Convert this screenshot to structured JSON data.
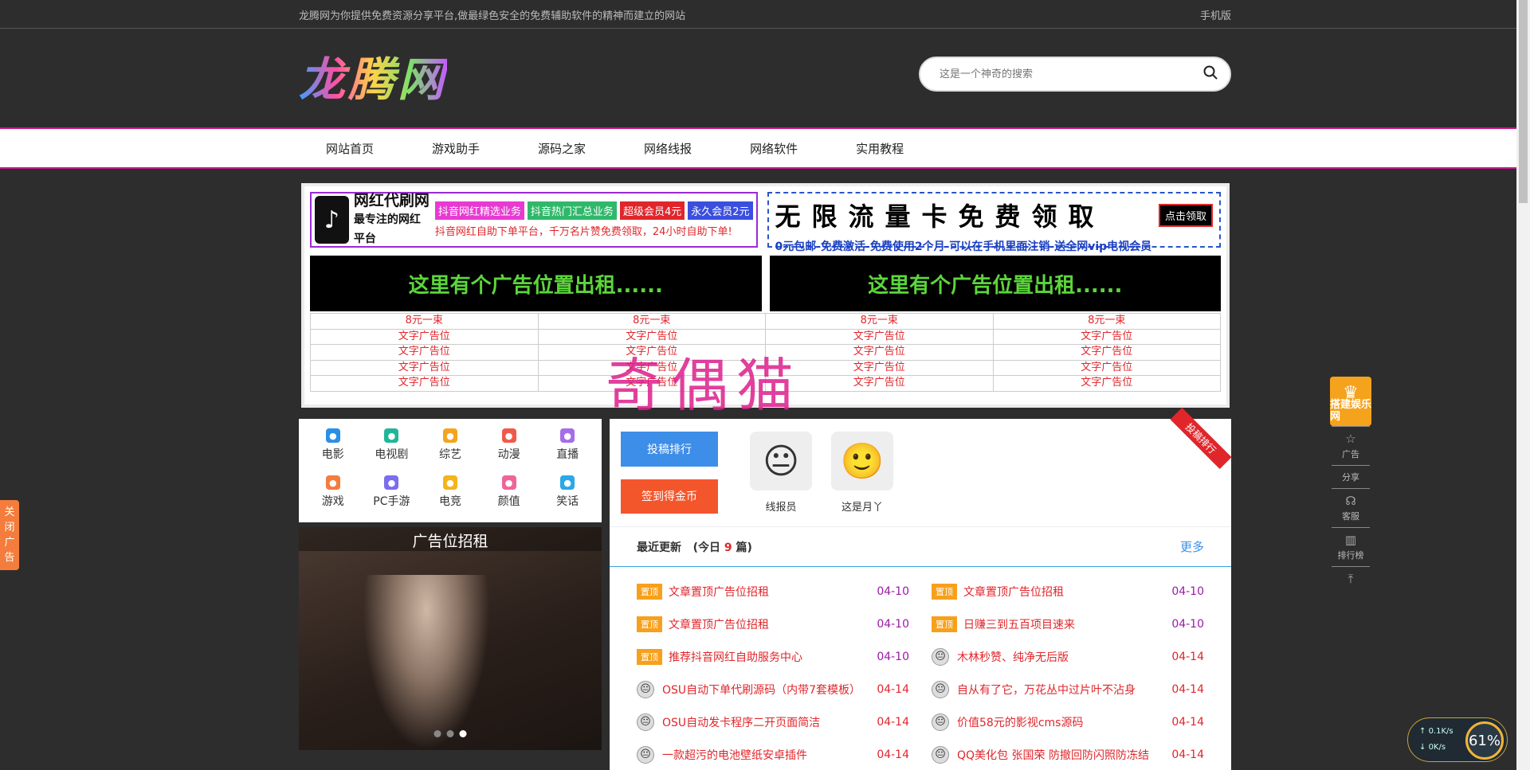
{
  "topbar": {
    "slogan": "龙腾网为你提供免费资源分享平台,做最绿色安全的免费辅助软件的精神而建立的网站",
    "mobile_link": "手机版"
  },
  "logo": {
    "text": "龙腾网"
  },
  "search": {
    "placeholder": "这是一个神奇的搜索",
    "icon": "search-icon"
  },
  "nav": {
    "items": [
      "网站首页",
      "游戏助手",
      "源码之家",
      "网络线报",
      "网络软件",
      "实用教程"
    ]
  },
  "ads": {
    "banner1": {
      "title": "网红代刷网",
      "subtitle": "最专注的网红平台",
      "tags": [
        {
          "label": "抖音网红精选业务",
          "color": "#e83ad2"
        },
        {
          "label": "抖音热门汇总业务",
          "color": "#2fb86a"
        },
        {
          "label": "超级会员4元",
          "color": "#e0262b"
        },
        {
          "label": "永久会员2元",
          "color": "#3a4fe0"
        }
      ],
      "tagline": "抖音网红自助下单平台，千万名片赞免费领取，24小时自助下单!"
    },
    "banner2": {
      "title": "无限流量卡免费领取",
      "button": "点击领取",
      "tagline": "0元包邮-免费激活-免费使用2个月-可以在手机里面注销-送全网vip电视会员"
    },
    "rent_left": "这里有个广告位置出租......",
    "rent_right": "这里有个广告位置出租......",
    "text_table": {
      "header": "8元一束",
      "cell": "文字广告位",
      "columns": 4,
      "rows": 4
    }
  },
  "watermark": "奇偶猫",
  "categories": [
    {
      "label": "电影",
      "icon": "movie-icon",
      "color": "#2a8fe8"
    },
    {
      "label": "电视剧",
      "icon": "tv-icon",
      "color": "#22b59a"
    },
    {
      "label": "综艺",
      "icon": "star-icon",
      "color": "#f4a51c"
    },
    {
      "label": "动漫",
      "icon": "cat-icon",
      "color": "#f05a4a"
    },
    {
      "label": "直播",
      "icon": "mic-icon",
      "color": "#a66de8"
    },
    {
      "label": "游戏",
      "icon": "gamepad-icon",
      "color": "#f47c3c"
    },
    {
      "label": "PC手游",
      "icon": "devices-icon",
      "color": "#7b6cf0"
    },
    {
      "label": "电竞",
      "icon": "trophy-icon",
      "color": "#f4b41c"
    },
    {
      "label": "颜值",
      "icon": "face-icon",
      "color": "#f0649a"
    },
    {
      "label": "笑话",
      "icon": "smile-icon",
      "color": "#2aa8e8"
    }
  ],
  "slider": {
    "caption": "广告位招租",
    "active_index": 2,
    "count": 3
  },
  "panel": {
    "ribbon": "投稿排行",
    "rank_button": "投稿排行",
    "sign_button": "签到得金币",
    "users": [
      {
        "name": "线报员",
        "avatar_label": "brother"
      },
      {
        "name": "这是月丫",
        "avatar_label": ""
      }
    ],
    "list_title": "最近更新",
    "today_prefix": "(今日",
    "today_count": "9",
    "today_suffix": "篇)",
    "more": "更多",
    "pin_label": "置顶",
    "items": [
      {
        "title": "文章置顶广告位招租",
        "date": "04-10",
        "pinned": true
      },
      {
        "title": "文章置顶广告位招租",
        "date": "04-10",
        "pinned": true
      },
      {
        "title": "文章置顶广告位招租",
        "date": "04-10",
        "pinned": true
      },
      {
        "title": "日赚三到五百项目速来",
        "date": "04-10",
        "pinned": true
      },
      {
        "title": "推荐抖音网红自助服务中心",
        "date": "04-10",
        "pinned": true
      },
      {
        "title": "木林秒赞、纯净无后版",
        "date": "04-14",
        "pinned": false
      },
      {
        "title": "OSU自动下单代刷源码（内带7套模板）",
        "date": "04-14",
        "pinned": false
      },
      {
        "title": "自从有了它，万花丛中过片叶不沾身",
        "date": "04-14",
        "pinned": false
      },
      {
        "title": "OSU自动发卡程序二开页面简洁",
        "date": "04-14",
        "pinned": false
      },
      {
        "title": "价值58元的影视cms源码",
        "date": "04-14",
        "pinned": false
      },
      {
        "title": "一款超污的电池壁纸安卓插件",
        "date": "04-14",
        "pinned": false
      },
      {
        "title": "QQ美化包 张国荣 防撤回防闪照防冻结",
        "date": "04-14",
        "pinned": false
      }
    ]
  },
  "sidetools": {
    "crown_text": "搭建娱乐网",
    "tools": [
      {
        "label": "广告",
        "icon": "star-outline-icon"
      },
      {
        "label": "分享",
        "icon": ""
      },
      {
        "label": "客服",
        "icon": "headset-icon"
      },
      {
        "label": "排行榜",
        "icon": "bar-chart-icon"
      },
      {
        "label": "",
        "icon": "back-to-top-icon"
      }
    ]
  },
  "close_ad": "关闭广告",
  "speed": {
    "up": "0.1K/s",
    "down": "0K/s",
    "percent": "61%"
  }
}
